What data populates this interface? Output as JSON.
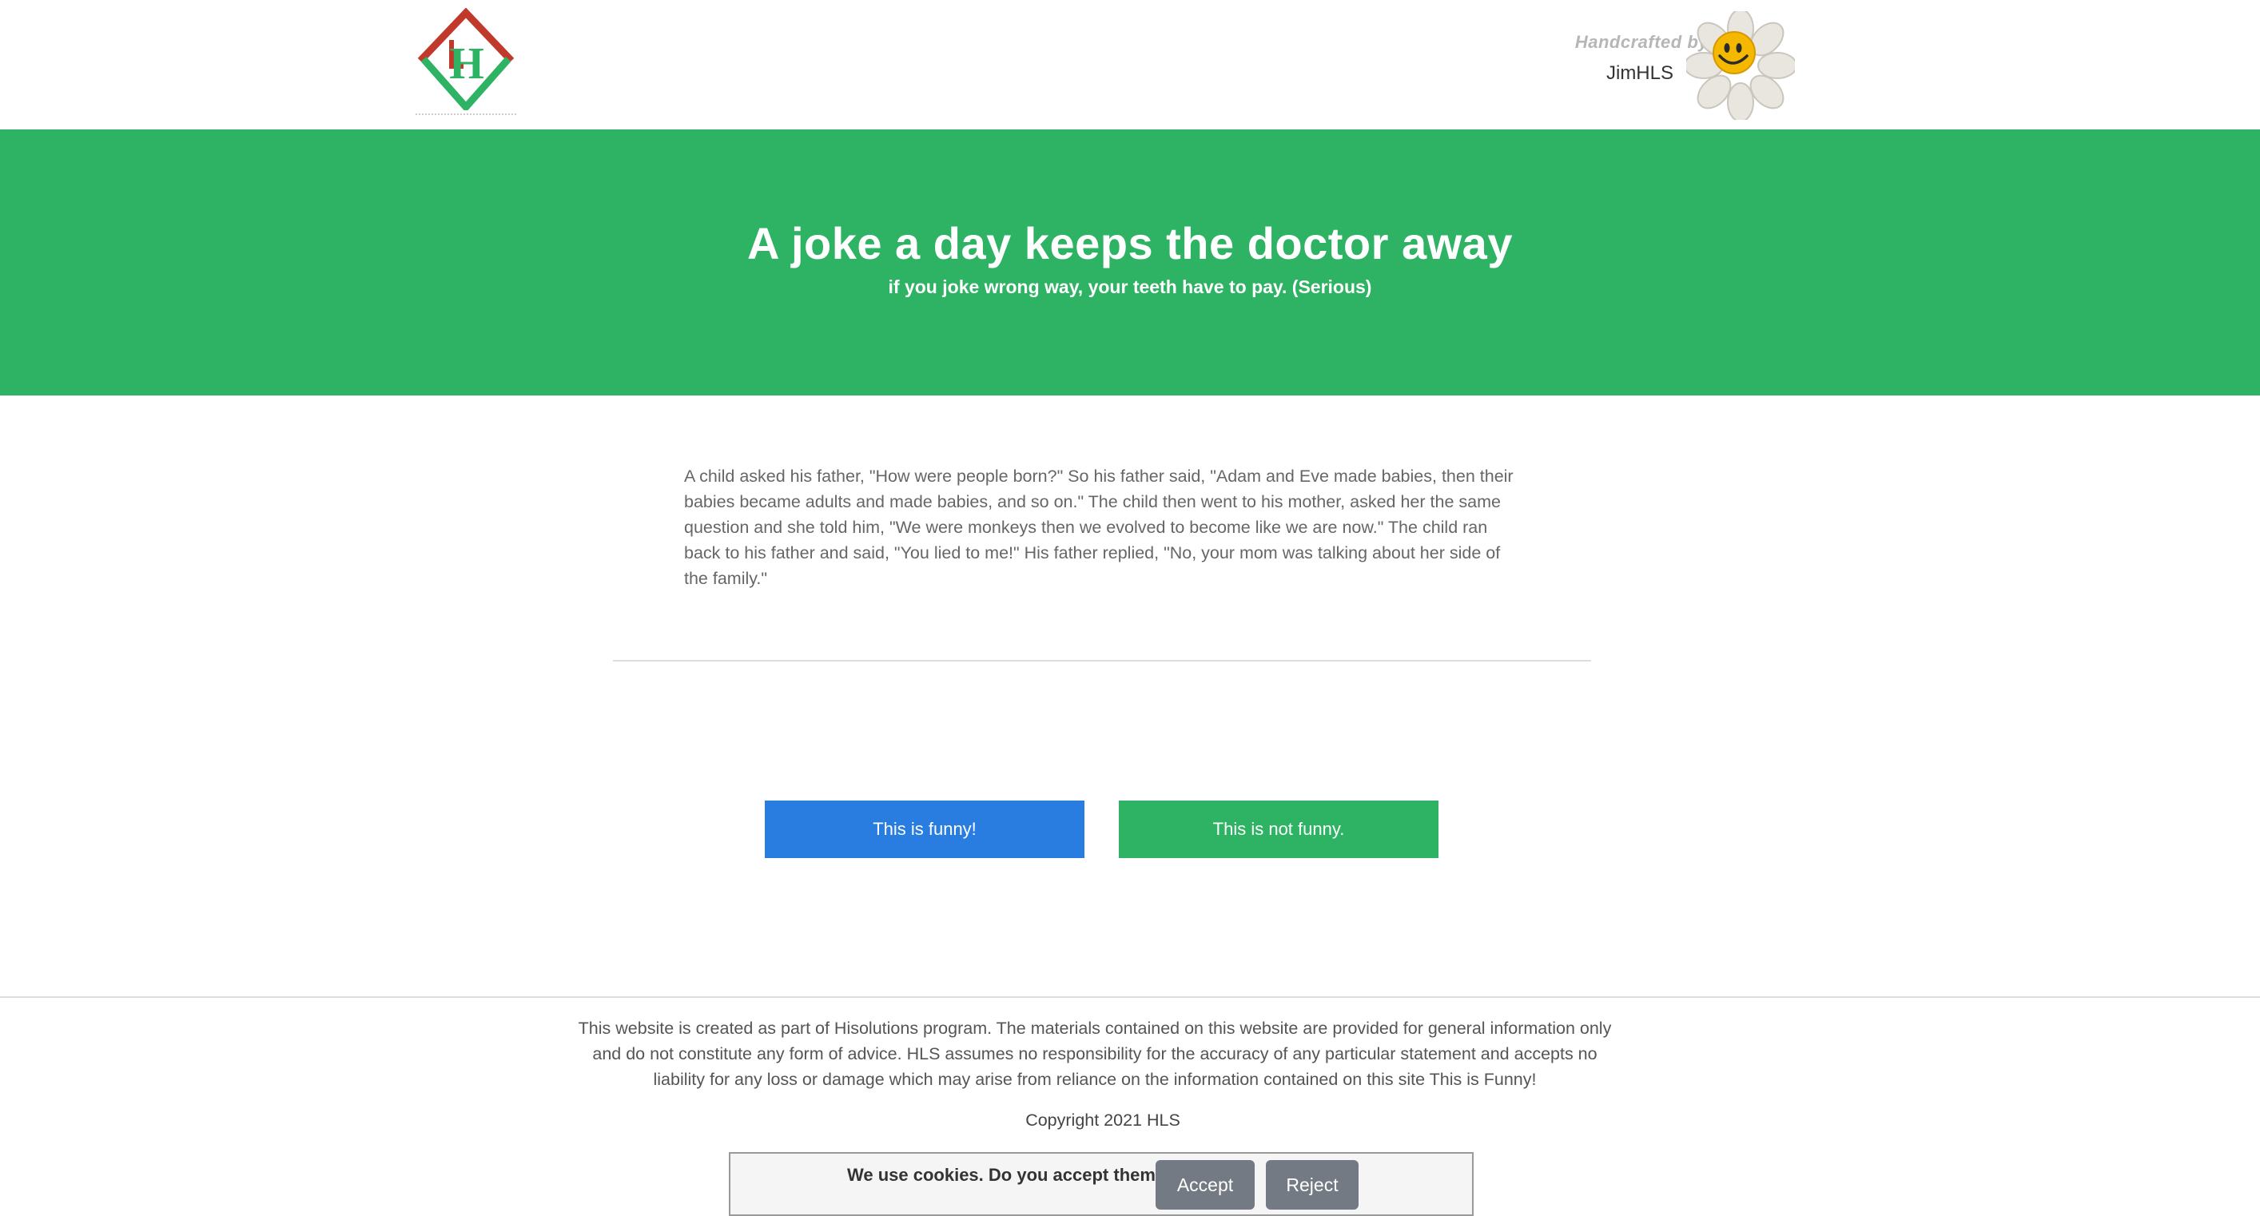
{
  "header": {
    "logo_letter": "H",
    "credit_label": "Handcrafted by",
    "credit_author": "JimHLS"
  },
  "hero": {
    "title": "A joke a day keeps the doctor away",
    "subtitle": "if you joke wrong way, your teeth have to pay. (Serious)"
  },
  "joke": {
    "text": "A child asked his father, \"How were people born?\" So his father said, \"Adam and Eve made babies, then their babies became adults and made babies, and so on.\" The child then went to his mother, asked her the same question and she told him, \"We were monkeys then we evolved to become like we are now.\" The child ran back to his father and said, \"You lied to me!\" His father replied, \"No, your mom was talking about her side of the family.\""
  },
  "actions": {
    "funny_label": "This is funny!",
    "not_funny_label": "This is not funny."
  },
  "footer": {
    "disclaimer": "This website is created as part of Hisolutions program. The materials contained on this website are provided for general information only and do not constitute any form of advice. HLS assumes no responsibility for the accuracy of any particular statement and accepts no liability for any loss or damage which may arise from reliance on the information contained on this site This is Funny!",
    "copyright": "Copyright 2021 HLS"
  },
  "cookie": {
    "message": "We use cookies. Do you accept them?",
    "accept_label": "Accept",
    "reject_label": "Reject"
  },
  "colors": {
    "brand_green": "#2db363",
    "funny_blue": "#2a7de0",
    "logo_red": "#c0392b",
    "logo_green": "#2db363"
  }
}
